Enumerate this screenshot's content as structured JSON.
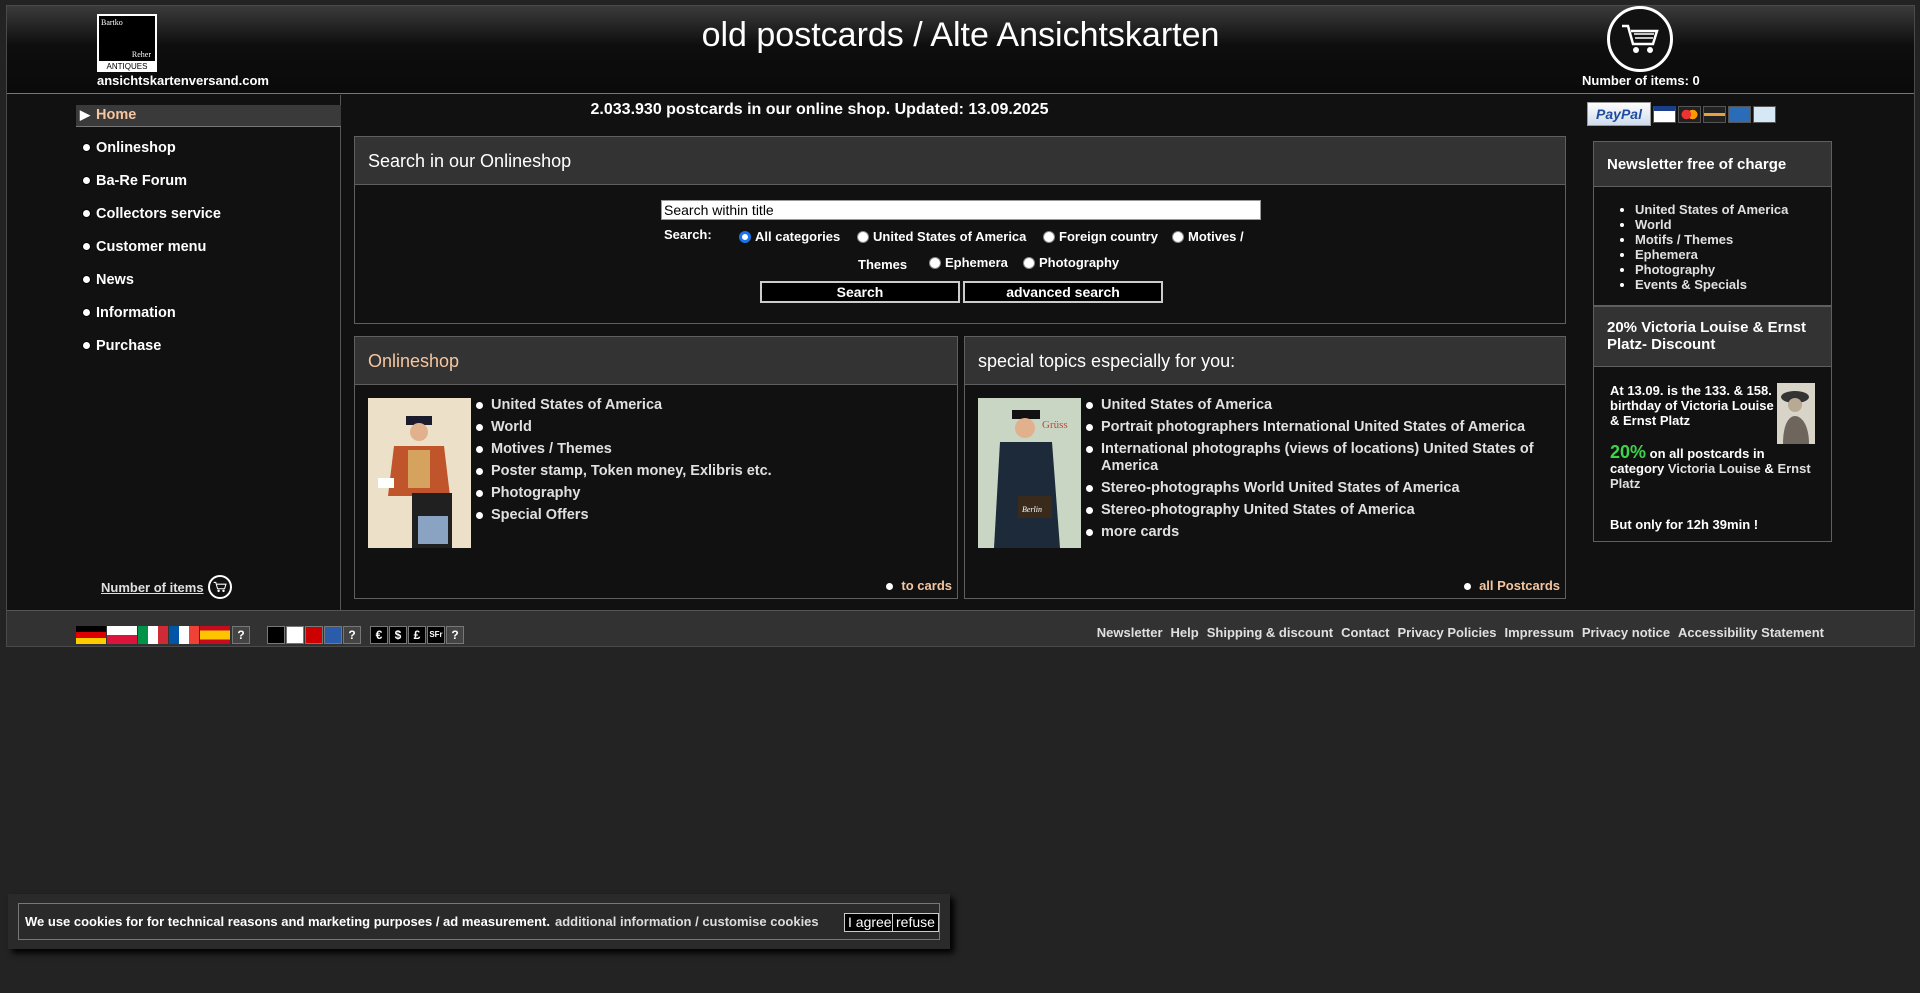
{
  "header": {
    "logo": {
      "line1": "Bartko",
      "line2": "Reher",
      "line3": "ANTIQUES"
    },
    "domain": "ansichtskartenversand.com",
    "title": "old postcards / Alte Ansichtskarten",
    "cart_label": "Number of items: 0"
  },
  "sidebar": {
    "items": [
      {
        "label": "Home",
        "active": true
      },
      {
        "label": "Onlineshop"
      },
      {
        "label": "Ba-Re Forum"
      },
      {
        "label": "Collectors service"
      },
      {
        "label": "Customer menu"
      },
      {
        "label": "News"
      },
      {
        "label": "Information"
      },
      {
        "label": "Purchase"
      }
    ],
    "items_link": "Number of items"
  },
  "counter": "2.033.930 postcards in our online shop. Updated: 13.09.2025",
  "search": {
    "title": "Search in our Onlineshop",
    "input_value": "Search within title",
    "label": "Search:",
    "options": [
      "All categories",
      "United States of America",
      "Foreign country",
      "Motives /",
      "Themes",
      "Ephemera",
      "Photography"
    ],
    "selected": "All categories",
    "search_button": "Search",
    "advanced_button": "advanced search"
  },
  "onlineshop": {
    "title": "Onlineshop",
    "links": [
      "United States of America",
      "World",
      "Motives / Themes",
      "Poster stamp, Token money, Exlibris etc.",
      "Photography",
      "Special Offers"
    ],
    "footer_link": "to cards"
  },
  "special": {
    "title": "special topics especially for you:",
    "links": [
      "United States of America",
      "Portrait photographers International United States of America",
      "International photographs (views of locations) United States of America",
      "Stereo-photographs World United States of America",
      "Stereo-photography United States of America",
      "more cards"
    ],
    "footer_link": "all Postcards",
    "card_word": "Berlin",
    "card_title": "Grüss"
  },
  "payment": {
    "paypal": "PayPal"
  },
  "newsletter": {
    "title": "Newsletter free of charge",
    "links": [
      "United States of America",
      "World",
      "Motifs / Themes",
      "Ephemera",
      "Photography",
      "Events & Specials"
    ]
  },
  "discount": {
    "title": "20% Victoria Louise & Ernst Platz- Discount",
    "intro": "At 13.09. is the 133. & 158. birthday of Victoria Louise & Ernst Platz",
    "pct": "20%",
    "offer_text": "on all postcards in category",
    "name1": "Victoria Louise",
    "amp": "&",
    "name2": "Ernst Platz",
    "time": "But only for 12h  39min !"
  },
  "footer": {
    "lang_help": "?",
    "color_help": "?",
    "currencies": [
      "€",
      "$",
      "£",
      "SFr"
    ],
    "currency_help": "?",
    "links": [
      "Newsletter",
      "Help",
      "Shipping & discount",
      "Contact",
      "Privacy Policies",
      "Impressum",
      "Privacy notice",
      "Accessibility Statement"
    ]
  },
  "cookie": {
    "text": "We use cookies for for technical reasons and marketing purposes / ad measurement.",
    "link": "additional information / customise cookies",
    "agree": "I agree",
    "refuse": "refuse"
  },
  "colors": {
    "accent": "#f5c6a0",
    "discount_green": "#3fd34a",
    "background": "#232323"
  }
}
